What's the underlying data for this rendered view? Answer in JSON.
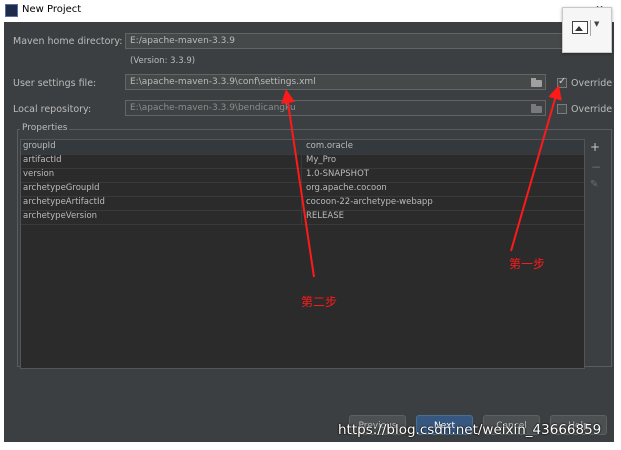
{
  "window": {
    "title": "New Project",
    "close": "x"
  },
  "form": {
    "maven_home": {
      "label": "Maven home directory:",
      "value": "E:/apache-maven-3.3.9",
      "version": "(Version: 3.3.9)"
    },
    "user_settings": {
      "label": "User settings file:",
      "value": "E:\\apache-maven-3.3.9\\conf\\settings.xml",
      "override_label": "Override",
      "override_checked": true
    },
    "local_repo": {
      "label": "Local repository:",
      "value": "E:\\apache-maven-3.3.9\\bendicangku",
      "override_label": "Override",
      "override_checked": false
    }
  },
  "properties": {
    "title": "Properties",
    "rows": [
      {
        "key": "groupId",
        "value": "com.oracle"
      },
      {
        "key": "artifactId",
        "value": "My_Pro"
      },
      {
        "key": "version",
        "value": "1.0-SNAPSHOT"
      },
      {
        "key": "archetypeGroupId",
        "value": "org.apache.cocoon"
      },
      {
        "key": "archetypeArtifactId",
        "value": "cocoon-22-archetype-webapp"
      },
      {
        "key": "archetypeVersion",
        "value": "RELEASE"
      }
    ],
    "tools": {
      "add": "+",
      "remove": "−",
      "edit": "✎"
    }
  },
  "buttons": {
    "previous": "Previous",
    "next": "Next",
    "cancel": "Cancel",
    "help": "Help"
  },
  "annotations": {
    "step1": "第一步",
    "step2": "第二步",
    "color": "#ff1a1a"
  },
  "watermark": "https://blog.csdn.net/weixin_43666859",
  "colors": {
    "dialog_bg": "#3c3f41",
    "primary_button": "#365880"
  }
}
